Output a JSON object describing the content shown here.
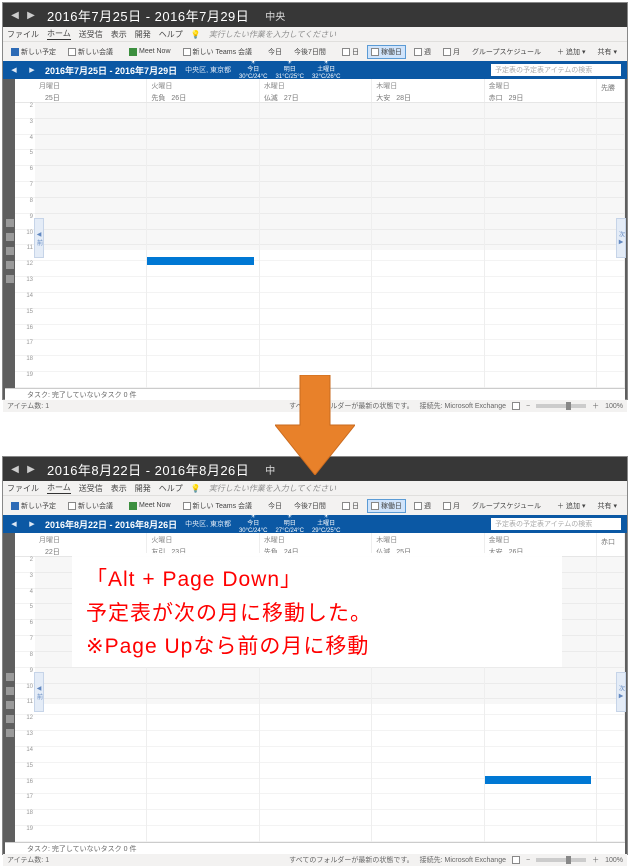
{
  "screens": [
    {
      "title_range": "2016年7月25日 - 2016年7月29日",
      "title_sub": "中央",
      "menu": {
        "file": "ファイル",
        "home": "ホーム",
        "sendrecv": "送受信",
        "view": "表示",
        "dev": "開発",
        "help": "ヘルプ",
        "hint": "実行したい作業を入力してください"
      },
      "ribbon": {
        "new_appt": "新しい予定",
        "new_meeting": "新しい会議",
        "meet_now": "Meet Now",
        "teams": "新しい Teams 会議",
        "today": "今日",
        "next7": "今後7日間",
        "day": "日",
        "workweek": "稼働日",
        "week": "週",
        "month": "月",
        "schedule": "グループスケジュール",
        "add": "追加",
        "share": "共有",
        "more": "…"
      },
      "sub_range": "2016年7月25日 - 2016年7月29日",
      "location": "中央区, 東京都",
      "weather": [
        {
          "lbl": "今日",
          "t": "30°C/24°C"
        },
        {
          "lbl": "明日",
          "t": "31°C/25°C"
        },
        {
          "lbl": "土曜日",
          "t": "32°C/26°C"
        }
      ],
      "search_placeholder": "予定表の予定表アイテムの検索",
      "days": [
        {
          "dow": "月曜日",
          "d": "25日",
          "roku": ""
        },
        {
          "dow": "火曜日",
          "d": "26日",
          "roku": "先負"
        },
        {
          "dow": "水曜日",
          "d": "27日",
          "roku": "仏滅"
        },
        {
          "dow": "木曜日",
          "d": "28日",
          "roku": "大安"
        },
        {
          "dow": "金曜日",
          "d": "29日",
          "roku": "赤口"
        }
      ],
      "extra_col": "先勝",
      "hours": [
        "2",
        "3",
        "4",
        "5",
        "6",
        "7",
        "8",
        "9",
        "10",
        "11",
        "12",
        "13",
        "14",
        "15",
        "16",
        "17",
        "18",
        "19"
      ],
      "event": {
        "col": 1,
        "top_pct": 54,
        "width_cols": 1
      },
      "tasks_label": "タスク: 完了していないタスク 0 件",
      "status_left": "アイテム数: 1",
      "status_mid": "すべてのフォルダーが最新の状態です。",
      "status_conn": "接続先: Microsoft Exchange",
      "zoom": "100%"
    },
    {
      "title_range": "2016年8月22日 - 2016年8月26日",
      "title_sub": "中",
      "menu": {
        "file": "ファイル",
        "home": "ホーム",
        "sendrecv": "送受信",
        "view": "表示",
        "dev": "開発",
        "help": "ヘルプ",
        "hint": "実行したい作業を入力してください"
      },
      "ribbon": {
        "new_appt": "新しい予定",
        "new_meeting": "新しい会議",
        "meet_now": "Meet Now",
        "teams": "新しい Teams 会議",
        "today": "今日",
        "next7": "今後7日間",
        "day": "日",
        "workweek": "稼働日",
        "week": "週",
        "month": "月",
        "schedule": "グループスケジュール",
        "add": "追加",
        "share": "共有",
        "more": "…"
      },
      "sub_range": "2016年8月22日 - 2016年8月26日",
      "location": "中央区, 東京都",
      "weather": [
        {
          "lbl": "今日",
          "t": "30°C/24°C"
        },
        {
          "lbl": "明日",
          "t": "27°C/24°C"
        },
        {
          "lbl": "土曜日",
          "t": "29°C/25°C"
        }
      ],
      "search_placeholder": "予定表の予定表アイテムの検索",
      "days": [
        {
          "dow": "月曜日",
          "d": "22日",
          "roku": ""
        },
        {
          "dow": "火曜日",
          "d": "23日",
          "roku": "友引"
        },
        {
          "dow": "水曜日",
          "d": "24日",
          "roku": "先負"
        },
        {
          "dow": "木曜日",
          "d": "25日",
          "roku": "仏滅"
        },
        {
          "dow": "金曜日",
          "d": "26日",
          "roku": "大安"
        }
      ],
      "extra_col": "赤口",
      "hours": [
        "2",
        "3",
        "4",
        "5",
        "6",
        "7",
        "8",
        "9",
        "10",
        "11",
        "12",
        "13",
        "14",
        "15",
        "16",
        "17",
        "18",
        "19"
      ],
      "event": {
        "col": 4,
        "top_pct": 77,
        "width_cols": 1
      },
      "tasks_label": "タスク: 完了していないタスク 0 件",
      "status_left": "アイテム数: 1",
      "status_mid": "すべてのフォルダーが最新の状態です。",
      "status_conn": "接続先: Microsoft Exchange",
      "zoom": "100%"
    }
  ],
  "annotation": {
    "line1": "「Alt + Page Down」",
    "line2": "予定表が次の月に移動した。",
    "line3": "※Page Upなら前の月に移動"
  }
}
